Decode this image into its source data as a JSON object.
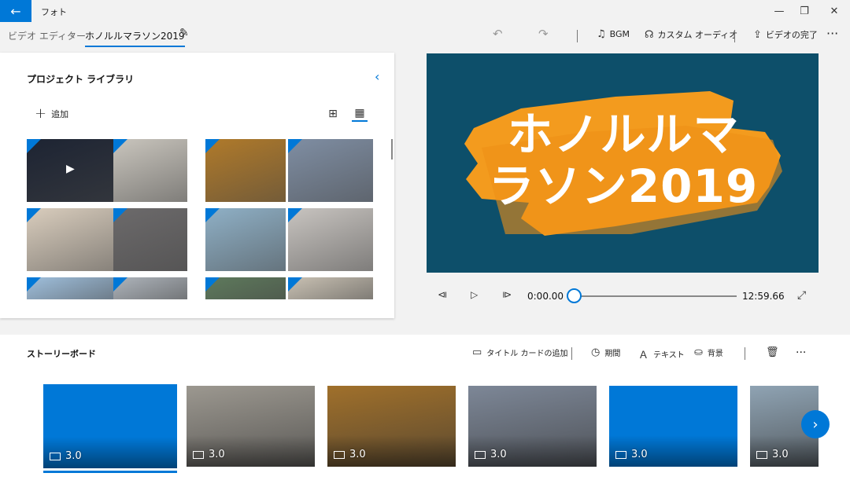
{
  "app": {
    "title": "フォト"
  },
  "breadcrumb": {
    "parent": "ビデオ エディター",
    "separator": "›",
    "current": "ホノルルマラソン2019"
  },
  "toolbar": {
    "bgm": "BGM",
    "custom_audio": "カスタム オーディオ",
    "finish_video": "ビデオの完了",
    "more": "···"
  },
  "library": {
    "title": "プロジェクト ライブラリ",
    "add_label": "追加",
    "collapse_icon": "chevron-left-icon",
    "view_small_icon": "small-grid-icon",
    "view_large_icon": "large-grid-icon",
    "thumbs": [
      {
        "color": "#1d2433",
        "video": true
      },
      {
        "color": "#c9c5bd"
      },
      {
        "color": "#b07a2a"
      },
      {
        "color": "#7f8ea3"
      },
      {
        "color": "#d9cdbd"
      },
      {
        "color": "#6c6a6b"
      },
      {
        "color": "#8fb0c6"
      },
      {
        "color": "#c8c4c0"
      },
      {
        "color": "#9fbfdc"
      },
      {
        "color": "#aeb4bb"
      },
      {
        "color": "#5e7a5c"
      },
      {
        "color": "#c9c1b3"
      }
    ]
  },
  "preview": {
    "title_line1": "ホノルルマ",
    "title_line2": "ラソン2019",
    "bg_color": "#0d4f6a",
    "accent_color": "#f39b1e"
  },
  "player": {
    "current_time": "0:00.00",
    "total_time": "12:59.66",
    "progress": 0
  },
  "storyboard": {
    "title": "ストーリーボード",
    "add_title_card": "タイトル カードの追加",
    "duration": "期間",
    "text": "テキスト",
    "background": "背景",
    "more": "···",
    "clips": [
      {
        "duration": "3.0",
        "color": "#0078d7",
        "title_card": true
      },
      {
        "duration": "3.0",
        "color": "#9c9890"
      },
      {
        "duration": "3.0",
        "color": "#a0702b"
      },
      {
        "duration": "3.0",
        "color": "#7d8797"
      },
      {
        "duration": "3.0",
        "color": "#0078d7",
        "title_card": true
      },
      {
        "duration": "3.0",
        "color": "#8fa3b3"
      }
    ]
  }
}
